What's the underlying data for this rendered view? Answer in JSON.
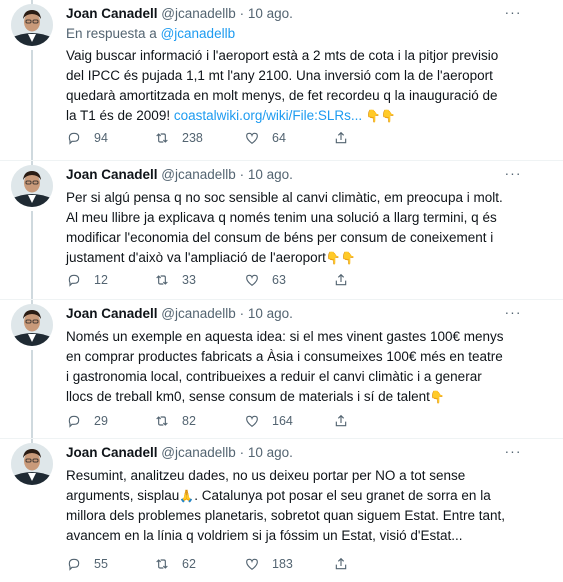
{
  "author": {
    "name": "Joan Canadell",
    "handle": "@jcanadellb",
    "avatar_icon": "profile-photo"
  },
  "colors": {
    "link": "#1d9bf0",
    "secondary_text": "#536471",
    "thread_line": "#cfd9de"
  },
  "tweets": [
    {
      "date": "· 10 ago.",
      "reply_label": "En respuesta a",
      "reply_handle": "@jcanadellb",
      "text": "Vaig buscar informació i l'aeroport està a 2 mts de cota i la pitjor previsio del IPCC és pujada 1,1 mt l'any 2100. Una inversió com la de l'aeroport quedarà amortitzada en molt menys, de fet recordeu q la inauguració de la T1 és de 2009!",
      "link": "coastalwiki.org/wiki/File:SLRs...",
      "emoji": "👇👇",
      "replies": "94",
      "retweets": "238",
      "likes": "64"
    },
    {
      "date": "· 10 ago.",
      "text": "Per si algú pensa q no soc sensible al canvi climàtic, em preocupa i molt. Al meu llibre ja explicava q només tenim una solució a llarg termini, q és modificar l'economia del consum de béns per consum de coneixement i justament d'això va l'ampliació de l'aeroport",
      "emoji": "👇👇",
      "replies": "12",
      "retweets": "33",
      "likes": "63"
    },
    {
      "date": "· 10 ago.",
      "text": "Només un exemple en aquesta idea: si el mes vinent gastes 100€ menys en comprar productes fabricats a Àsia i consumeixes 100€ més en teatre i gastronomia local, contribueixes a reduir el canvi climàtic i a generar llocs de treball km0, sense consum de materials i sí de talent",
      "emoji": "👇",
      "replies": "29",
      "retweets": "82",
      "likes": "164"
    },
    {
      "date": "· 10 ago.",
      "text_before": "Resumint, analitzeu dades, no us deixeu portar per NO a tot sense arguments, sisplau",
      "emoji": "🙏",
      "text_after": ". Catalunya pot posar el seu granet de sorra en la millora dels problemes planetaris, sobretot quan siguem Estat. Entre tant, avancem en la línia q voldriem si ja fóssim un Estat, visió d'Estat...",
      "replies": "55",
      "retweets": "62",
      "likes": "183"
    }
  ],
  "more_icon": "more-dots-icon"
}
